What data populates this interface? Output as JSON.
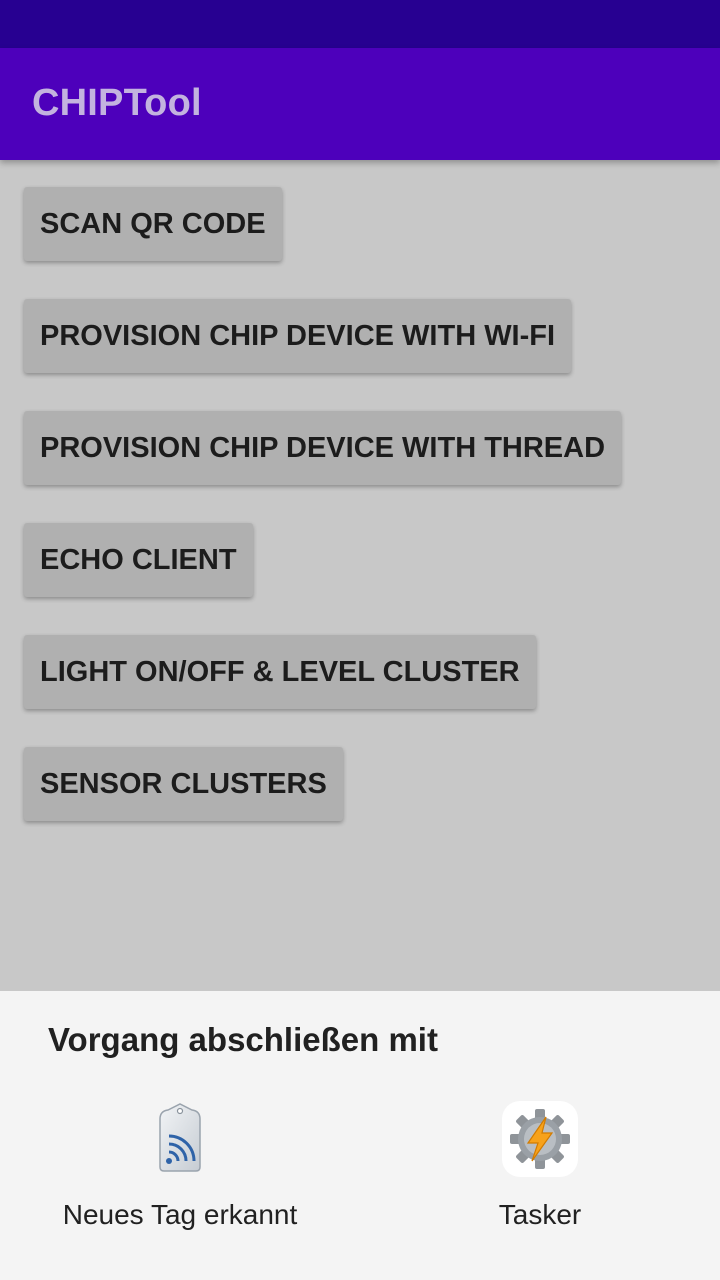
{
  "app_bar": {
    "title": "CHIPTool"
  },
  "buttons": [
    {
      "label": "SCAN QR CODE"
    },
    {
      "label": "PROVISION CHIP DEVICE WITH WI-FI"
    },
    {
      "label": "PROVISION CHIP DEVICE WITH THREAD"
    },
    {
      "label": "ECHO CLIENT"
    },
    {
      "label": "LIGHT ON/OFF & LEVEL CLUSTER"
    },
    {
      "label": "SENSOR CLUSTERS"
    }
  ],
  "chooser": {
    "title": "Vorgang abschließen mit",
    "apps": [
      {
        "label": "Neues Tag erkannt",
        "icon": "nfc-tag-icon"
      },
      {
        "label": "Tasker",
        "icon": "tasker-icon"
      }
    ]
  },
  "colors": {
    "status_bar": "#270091",
    "app_bar": "#4d00bb",
    "background": "#c8c8c8",
    "button": "#b0b0b0",
    "sheet": "#f4f4f4"
  }
}
